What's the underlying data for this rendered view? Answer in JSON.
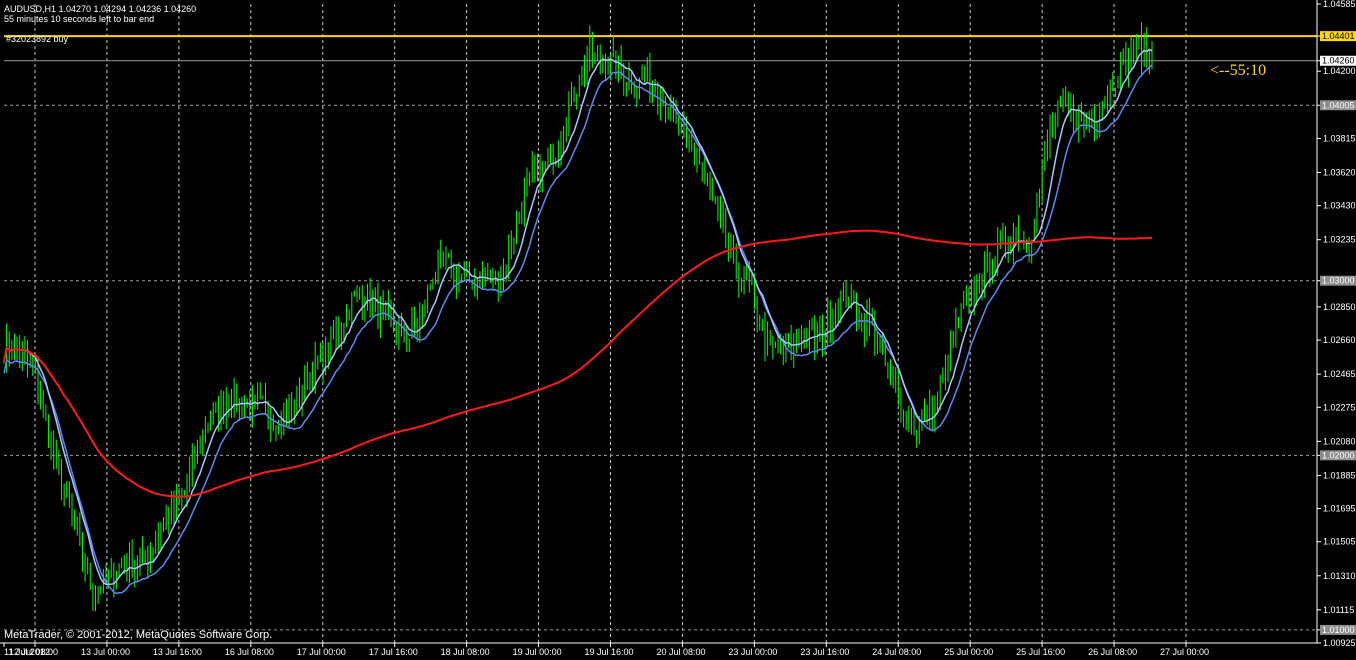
{
  "header": {
    "line1": "AUDUSD,H1  1.04270 1.04294 1.04236 1.04260",
    "line2": "55 minutes 10 seconds left to bar end"
  },
  "order_label": "#32023892 buy",
  "countdown": "<--55:10",
  "copyright": "MetaTrader, © 2001-2012, MetaQuotes Software Corp.",
  "chart_data": {
    "type": "candlestick",
    "symbol": "AUDUSD",
    "timeframe": "H1",
    "ohlc_current": {
      "open": 1.0427,
      "high": 1.04294,
      "low": 1.04236,
      "close": 1.0426
    },
    "y_axis": {
      "ticks": [
        "1.04585",
        "1.04401",
        "1.04260",
        "1.04200",
        "1.04005",
        "1.03815",
        "1.03620",
        "1.03430",
        "1.03235",
        "1.03000",
        "1.02850",
        "1.02660",
        "1.02465",
        "1.02275",
        "1.02080",
        "1.02000",
        "1.01885",
        "1.01695",
        "1.01505",
        "1.01310",
        "1.01115",
        "1.01000",
        "1.00925"
      ],
      "ylim": [
        1.00925,
        1.04585
      ],
      "highlighted": [
        {
          "label": "1.04401",
          "value": 1.04401,
          "kind": "order",
          "bg": "#ffd800",
          "fg": "#000000"
        },
        {
          "label": "1.04260",
          "value": 1.0426,
          "kind": "bid",
          "bg": "#ffffff",
          "fg": "#000000"
        },
        {
          "label": "1.04005",
          "value": 1.04005,
          "kind": "level",
          "bg": "#8c8c8c",
          "fg": "#ffffff"
        },
        {
          "label": "1.03000",
          "value": 1.03,
          "kind": "level",
          "bg": "#8c8c8c",
          "fg": "#ffffff"
        },
        {
          "label": "1.02000",
          "value": 1.02,
          "kind": "level",
          "bg": "#8c8c8c",
          "fg": "#ffffff"
        },
        {
          "label": "1.01000",
          "value": 1.01,
          "kind": "level",
          "bg": "#8c8c8c",
          "fg": "#ffffff"
        }
      ]
    },
    "x_axis": {
      "ticks": [
        "11 Jul 2012",
        "12 Jul 08:00",
        "13 Jul 00:00",
        "13 Jul 16:00",
        "16 Jul 08:00",
        "17 Jul 00:00",
        "17 Jul 16:00",
        "18 Jul 08:00",
        "19 Jul 00:00",
        "19 Jul 16:00",
        "20 Jul 08:00",
        "23 Jul 00:00",
        "23 Jul 16:00",
        "24 Jul 08:00",
        "25 Jul 00:00",
        "25 Jul 16:00",
        "26 Jul 08:00",
        "27 Jul 00:00"
      ]
    },
    "order_line": {
      "label": "#32023892 buy",
      "value": 1.04401
    },
    "series": [
      {
        "name": "price",
        "color": "#00ff00",
        "values": [
          1.0262,
          1.0262,
          1.0254,
          1.024,
          1.021,
          1.0186,
          1.0165,
          1.014,
          1.012,
          1.0128,
          1.0135,
          1.014,
          1.0135,
          1.0145,
          1.016,
          1.0168,
          1.0175,
          1.02,
          1.022,
          1.0225,
          1.0235,
          1.023,
          1.0228,
          1.0226,
          1.022,
          1.0222,
          1.0232,
          1.0245,
          1.0252,
          1.0262,
          1.0275,
          1.029,
          1.0292,
          1.0285,
          1.0278,
          1.027,
          1.0268,
          1.0278,
          1.0302,
          1.031,
          1.0305,
          1.03,
          1.0303,
          1.03,
          1.03,
          1.032,
          1.0345,
          1.036,
          1.0365,
          1.0375,
          1.0395,
          1.0415,
          1.043,
          1.0425,
          1.0425,
          1.042,
          1.0412,
          1.0415,
          1.0413,
          1.0398,
          1.0385,
          1.0375,
          1.0365,
          1.0345,
          1.0325,
          1.0305,
          1.03,
          1.028,
          1.0262,
          1.026,
          1.0262,
          1.0272,
          1.0265,
          1.0272,
          1.029,
          1.029,
          1.028,
          1.0275,
          1.0255,
          1.024,
          1.0225,
          1.0215,
          1.0225,
          1.0232,
          1.0258,
          1.028,
          1.029,
          1.0305,
          1.0315,
          1.032,
          1.033,
          1.032,
          1.035,
          1.039,
          1.0398,
          1.0395,
          1.039,
          1.0395,
          1.041,
          1.042,
          1.043,
          1.0435,
          1.0426
        ]
      },
      {
        "name": "fast-ma",
        "color": "#5b8af5"
      },
      {
        "name": "mid-ma",
        "color": "#a8c8ff"
      },
      {
        "name": "slow-ma",
        "color": "#ff1a1a"
      }
    ],
    "grid": true,
    "grid_style": "dashed"
  }
}
